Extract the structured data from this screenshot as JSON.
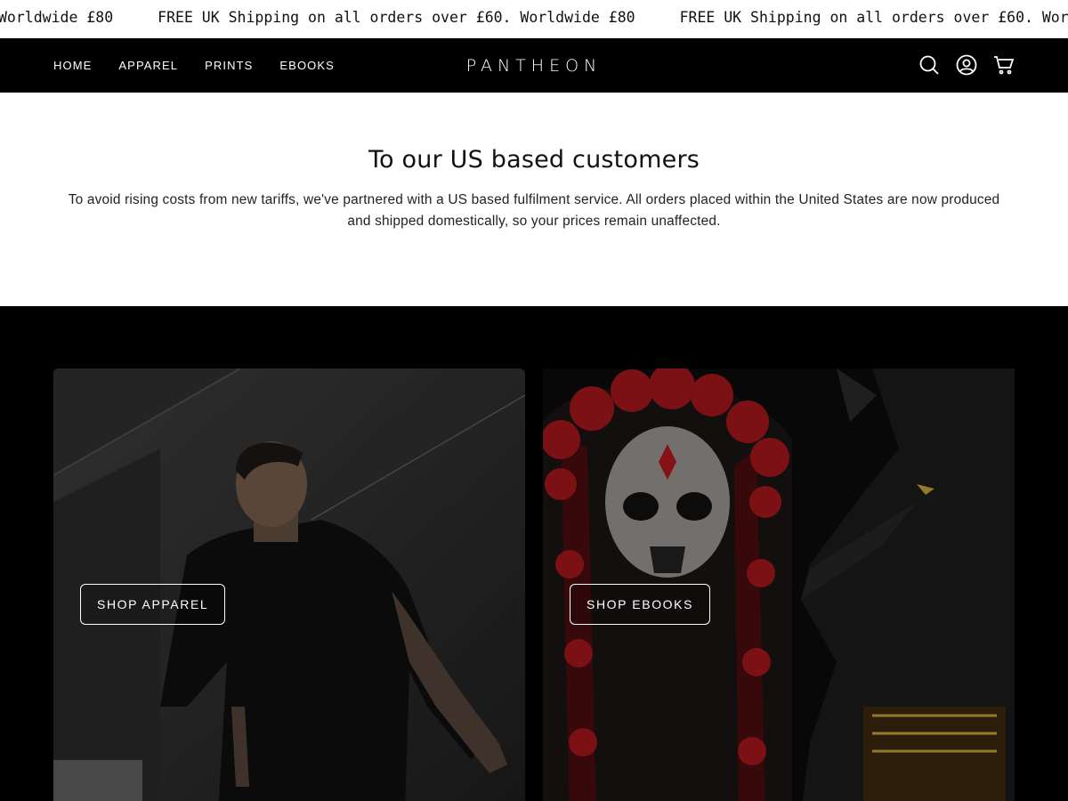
{
  "announcement": {
    "segments": [
      "Worldwide £80",
      "FREE UK Shipping on all orders over £60. Worldwide £80",
      "FREE UK Shipping on all orders over £60. Worldwide £80"
    ]
  },
  "nav": {
    "links": [
      "HOME",
      "APPAREL",
      "PRINTS",
      "EBOOKS"
    ],
    "logo": "PANTHEON",
    "icons": [
      "search-icon",
      "account-icon",
      "cart-icon"
    ]
  },
  "notice": {
    "title": "To our US based customers",
    "body": "To avoid rising costs from new tariffs, we've partnered with a US based fulfilment service. All orders placed within the United States are now produced and shipped domestically, so your prices remain unaffected."
  },
  "panels": {
    "apparel_button": "SHOP APPAREL",
    "ebooks_button": "SHOP EBOOKS"
  },
  "colors": {
    "header_bg": "#000000",
    "announcement_bg": "#ffffff",
    "accent_red": "#b0191e",
    "gold": "#c9a13a"
  }
}
